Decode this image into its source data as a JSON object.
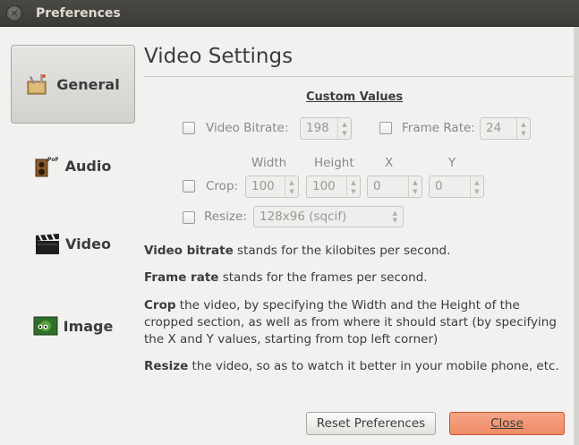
{
  "window": {
    "title": "Preferences"
  },
  "sidebar": {
    "items": [
      {
        "label": "General",
        "icon": "general-settings-icon",
        "active": true
      },
      {
        "label": "Audio",
        "icon": "speakers-icon",
        "active": false
      },
      {
        "label": "Video",
        "icon": "clapperboard-icon",
        "active": false
      },
      {
        "label": "Image",
        "icon": "picture-icon",
        "active": false
      }
    ]
  },
  "main": {
    "section_title": "Video Settings",
    "custom_values_heading": "Custom Values",
    "video_bitrate": {
      "label": "Video Bitrate:",
      "value": "198",
      "checked": false
    },
    "frame_rate": {
      "label": "Frame Rate:",
      "value": "24",
      "checked": false
    },
    "crop": {
      "label": "Crop:",
      "checked": false,
      "headers": {
        "width": "Width",
        "height": "Height",
        "x": "X",
        "y": "Y"
      },
      "values": {
        "width": "100",
        "height": "100",
        "x": "0",
        "y": "0"
      }
    },
    "resize": {
      "label": "Resize:",
      "value": "128x96 (sqcif)",
      "checked": false
    },
    "descriptions": [
      {
        "bold": "Video bitrate",
        "text": " stands for the kilobites per second."
      },
      {
        "bold": "Frame rate",
        "text": " stands for the frames per second."
      },
      {
        "bold": "Crop",
        "text": " the video, by specifying the Width and the Height of the cropped section, as well as from where it should start (by specifying the X and Y values, starting from top left corner)"
      },
      {
        "bold": "Resize",
        "text": " the video, so as to watch it better in your mobile phone, etc."
      }
    ]
  },
  "footer": {
    "reset_label": "Reset Preferences",
    "close_label": "Close"
  },
  "colors": {
    "accent": "#ef8a63",
    "titlebar": "#3c3b37"
  }
}
